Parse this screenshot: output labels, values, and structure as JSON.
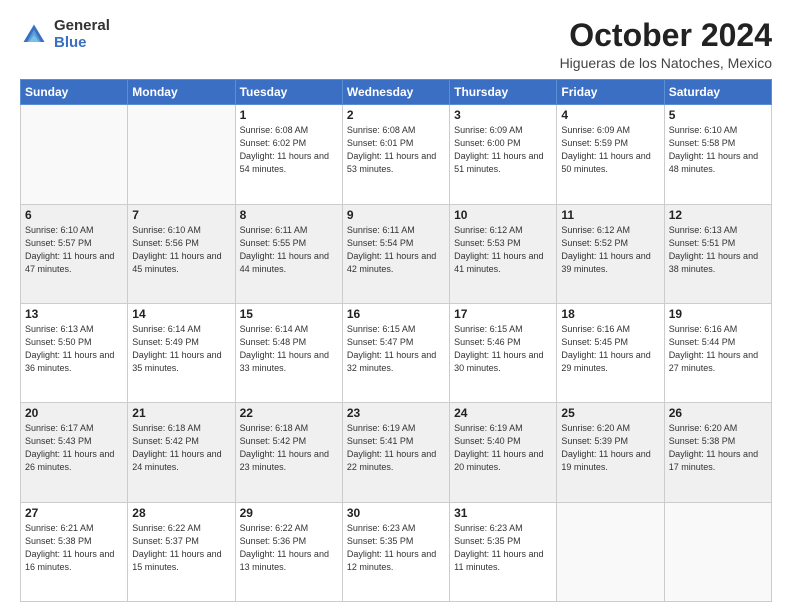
{
  "logo": {
    "general": "General",
    "blue": "Blue"
  },
  "header": {
    "month": "October 2024",
    "location": "Higueras de los Natoches, Mexico"
  },
  "weekdays": [
    "Sunday",
    "Monday",
    "Tuesday",
    "Wednesday",
    "Thursday",
    "Friday",
    "Saturday"
  ],
  "weeks": [
    [
      {
        "day": null
      },
      {
        "day": null
      },
      {
        "day": "1",
        "sunrise": "Sunrise: 6:08 AM",
        "sunset": "Sunset: 6:02 PM",
        "daylight": "Daylight: 11 hours and 54 minutes."
      },
      {
        "day": "2",
        "sunrise": "Sunrise: 6:08 AM",
        "sunset": "Sunset: 6:01 PM",
        "daylight": "Daylight: 11 hours and 53 minutes."
      },
      {
        "day": "3",
        "sunrise": "Sunrise: 6:09 AM",
        "sunset": "Sunset: 6:00 PM",
        "daylight": "Daylight: 11 hours and 51 minutes."
      },
      {
        "day": "4",
        "sunrise": "Sunrise: 6:09 AM",
        "sunset": "Sunset: 5:59 PM",
        "daylight": "Daylight: 11 hours and 50 minutes."
      },
      {
        "day": "5",
        "sunrise": "Sunrise: 6:10 AM",
        "sunset": "Sunset: 5:58 PM",
        "daylight": "Daylight: 11 hours and 48 minutes."
      }
    ],
    [
      {
        "day": "6",
        "sunrise": "Sunrise: 6:10 AM",
        "sunset": "Sunset: 5:57 PM",
        "daylight": "Daylight: 11 hours and 47 minutes."
      },
      {
        "day": "7",
        "sunrise": "Sunrise: 6:10 AM",
        "sunset": "Sunset: 5:56 PM",
        "daylight": "Daylight: 11 hours and 45 minutes."
      },
      {
        "day": "8",
        "sunrise": "Sunrise: 6:11 AM",
        "sunset": "Sunset: 5:55 PM",
        "daylight": "Daylight: 11 hours and 44 minutes."
      },
      {
        "day": "9",
        "sunrise": "Sunrise: 6:11 AM",
        "sunset": "Sunset: 5:54 PM",
        "daylight": "Daylight: 11 hours and 42 minutes."
      },
      {
        "day": "10",
        "sunrise": "Sunrise: 6:12 AM",
        "sunset": "Sunset: 5:53 PM",
        "daylight": "Daylight: 11 hours and 41 minutes."
      },
      {
        "day": "11",
        "sunrise": "Sunrise: 6:12 AM",
        "sunset": "Sunset: 5:52 PM",
        "daylight": "Daylight: 11 hours and 39 minutes."
      },
      {
        "day": "12",
        "sunrise": "Sunrise: 6:13 AM",
        "sunset": "Sunset: 5:51 PM",
        "daylight": "Daylight: 11 hours and 38 minutes."
      }
    ],
    [
      {
        "day": "13",
        "sunrise": "Sunrise: 6:13 AM",
        "sunset": "Sunset: 5:50 PM",
        "daylight": "Daylight: 11 hours and 36 minutes."
      },
      {
        "day": "14",
        "sunrise": "Sunrise: 6:14 AM",
        "sunset": "Sunset: 5:49 PM",
        "daylight": "Daylight: 11 hours and 35 minutes."
      },
      {
        "day": "15",
        "sunrise": "Sunrise: 6:14 AM",
        "sunset": "Sunset: 5:48 PM",
        "daylight": "Daylight: 11 hours and 33 minutes."
      },
      {
        "day": "16",
        "sunrise": "Sunrise: 6:15 AM",
        "sunset": "Sunset: 5:47 PM",
        "daylight": "Daylight: 11 hours and 32 minutes."
      },
      {
        "day": "17",
        "sunrise": "Sunrise: 6:15 AM",
        "sunset": "Sunset: 5:46 PM",
        "daylight": "Daylight: 11 hours and 30 minutes."
      },
      {
        "day": "18",
        "sunrise": "Sunrise: 6:16 AM",
        "sunset": "Sunset: 5:45 PM",
        "daylight": "Daylight: 11 hours and 29 minutes."
      },
      {
        "day": "19",
        "sunrise": "Sunrise: 6:16 AM",
        "sunset": "Sunset: 5:44 PM",
        "daylight": "Daylight: 11 hours and 27 minutes."
      }
    ],
    [
      {
        "day": "20",
        "sunrise": "Sunrise: 6:17 AM",
        "sunset": "Sunset: 5:43 PM",
        "daylight": "Daylight: 11 hours and 26 minutes."
      },
      {
        "day": "21",
        "sunrise": "Sunrise: 6:18 AM",
        "sunset": "Sunset: 5:42 PM",
        "daylight": "Daylight: 11 hours and 24 minutes."
      },
      {
        "day": "22",
        "sunrise": "Sunrise: 6:18 AM",
        "sunset": "Sunset: 5:42 PM",
        "daylight": "Daylight: 11 hours and 23 minutes."
      },
      {
        "day": "23",
        "sunrise": "Sunrise: 6:19 AM",
        "sunset": "Sunset: 5:41 PM",
        "daylight": "Daylight: 11 hours and 22 minutes."
      },
      {
        "day": "24",
        "sunrise": "Sunrise: 6:19 AM",
        "sunset": "Sunset: 5:40 PM",
        "daylight": "Daylight: 11 hours and 20 minutes."
      },
      {
        "day": "25",
        "sunrise": "Sunrise: 6:20 AM",
        "sunset": "Sunset: 5:39 PM",
        "daylight": "Daylight: 11 hours and 19 minutes."
      },
      {
        "day": "26",
        "sunrise": "Sunrise: 6:20 AM",
        "sunset": "Sunset: 5:38 PM",
        "daylight": "Daylight: 11 hours and 17 minutes."
      }
    ],
    [
      {
        "day": "27",
        "sunrise": "Sunrise: 6:21 AM",
        "sunset": "Sunset: 5:38 PM",
        "daylight": "Daylight: 11 hours and 16 minutes."
      },
      {
        "day": "28",
        "sunrise": "Sunrise: 6:22 AM",
        "sunset": "Sunset: 5:37 PM",
        "daylight": "Daylight: 11 hours and 15 minutes."
      },
      {
        "day": "29",
        "sunrise": "Sunrise: 6:22 AM",
        "sunset": "Sunset: 5:36 PM",
        "daylight": "Daylight: 11 hours and 13 minutes."
      },
      {
        "day": "30",
        "sunrise": "Sunrise: 6:23 AM",
        "sunset": "Sunset: 5:35 PM",
        "daylight": "Daylight: 11 hours and 12 minutes."
      },
      {
        "day": "31",
        "sunrise": "Sunrise: 6:23 AM",
        "sunset": "Sunset: 5:35 PM",
        "daylight": "Daylight: 11 hours and 11 minutes."
      },
      {
        "day": null
      },
      {
        "day": null
      }
    ]
  ]
}
